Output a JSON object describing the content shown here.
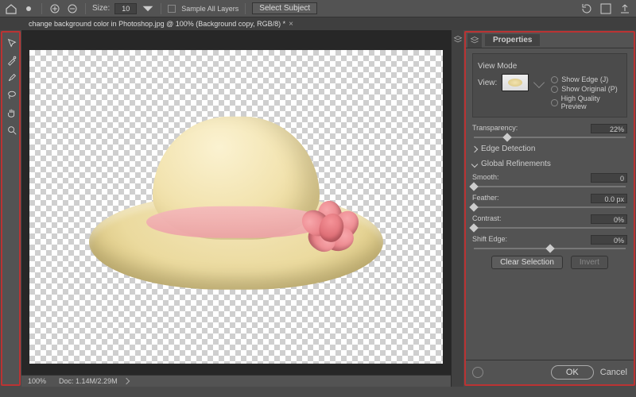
{
  "optbar": {
    "size_label": "Size:",
    "size_value": "10",
    "sample_all": "Sample All Layers",
    "select_subject": "Select Subject"
  },
  "tab": {
    "title": "change background color in Photoshop.jpg @ 100% (Background copy, RGB/8) *"
  },
  "status": {
    "zoom": "100%",
    "doc": "Doc: 1.14M/2.29M"
  },
  "props": {
    "title": "Properties",
    "view_mode": "View Mode",
    "view_label": "View:",
    "show_edge": "Show Edge (J)",
    "show_original": "Show Original (P)",
    "hq_preview": "High Quality Preview",
    "transparency_label": "Transparency:",
    "transparency_value": "22%",
    "edge_detection": "Edge Detection",
    "global_refine": "Global Refinements",
    "smooth_label": "Smooth:",
    "smooth_value": "0",
    "feather_label": "Feather:",
    "feather_value": "0.0 px",
    "contrast_label": "Contrast:",
    "contrast_value": "0%",
    "shift_label": "Shift Edge:",
    "shift_value": "0%",
    "clear_sel": "Clear Selection",
    "invert": "Invert",
    "ok": "OK",
    "cancel": "Cancel"
  }
}
